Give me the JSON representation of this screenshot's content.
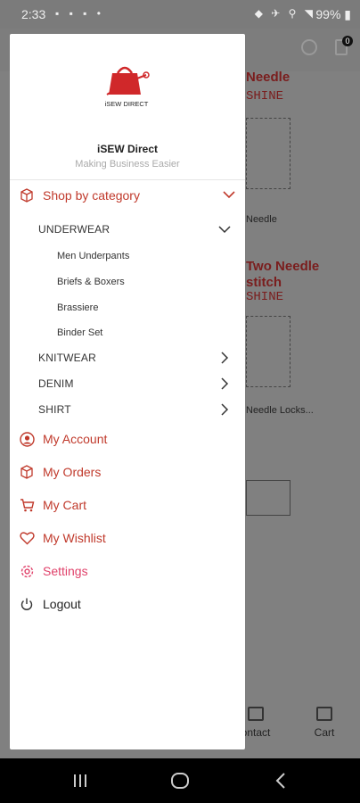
{
  "status_bar": {
    "time": "2:33",
    "battery": "99%"
  },
  "background": {
    "card1_title": "Needle",
    "card1_sub": "SHINE",
    "card1_label": "Needle",
    "card2_title": "Two Needle",
    "card2_title2": "stitch",
    "card2_sub": "SHINE",
    "card2_label": "Needle Locks...",
    "cart_badge": "0",
    "nav_contact": "ontact",
    "nav_cart": "Cart"
  },
  "drawer": {
    "logo_text": "iSEW DIRECT",
    "app_name": "iSEW Direct",
    "tagline": "Making Business Easier",
    "shop_by_category": "Shop by category",
    "categories": [
      {
        "label": "UNDERWEAR"
      },
      {
        "label": "KNITWEAR"
      },
      {
        "label": "DENIM"
      },
      {
        "label": "SHIRT"
      }
    ],
    "underwear_items": [
      "Men Underpants",
      "Briefs & Boxers",
      "Brassiere",
      "Binder Set"
    ],
    "menu": {
      "my_account": "My Account",
      "my_orders": "My Orders",
      "my_cart": "My Cart",
      "my_wishlist": "My Wishlist",
      "settings": "Settings",
      "logout": "Logout"
    }
  },
  "colors": {
    "accent": "#c0392b",
    "settings": "#e0416a"
  }
}
